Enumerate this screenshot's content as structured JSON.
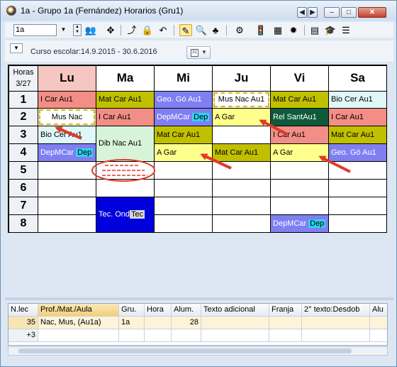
{
  "window": {
    "title": "1a - Grupo 1a (Fernández)  Horarios  (Gru1)"
  },
  "titlebar_buttons": {
    "prev": "◀",
    "next": "▶",
    "minimize": "–",
    "maximize": "□",
    "close": "✕"
  },
  "toolbar": {
    "class_value": "1a"
  },
  "course": {
    "label": "Curso escolar:14.9.2015 - 30.6.2016"
  },
  "timetable": {
    "corner_line1": "Horas",
    "corner_line2": "3/27",
    "days": [
      "Lu",
      "Ma",
      "Mi",
      "Ju",
      "Vi",
      "Sa"
    ],
    "periods": [
      "1",
      "2",
      "3",
      "4",
      "5",
      "6",
      "7",
      "8"
    ],
    "lessons": [
      {
        "text": "I   Car Au1",
        "tag": "",
        "bg": "#f28e86"
      },
      {
        "text": "Mus  Nac",
        "tag": "",
        "bg": "#ffffff"
      },
      {
        "text": "Bio  Cer Au1",
        "tag": "",
        "bg": "#e0f7f9"
      },
      {
        "text": "DepMCar ",
        "tag": "Dep",
        "bg": "#7f7ff2"
      },
      {
        "text": "Mat Car Au1",
        "tag": "",
        "bg": "#c0c000"
      },
      {
        "text": "I   Car Au1",
        "tag": "",
        "bg": "#f28e86"
      },
      {
        "text": "Dib  Nac Au1",
        "tag": "",
        "bg": "#d8f4d8"
      },
      {
        "text": "Tec. Ond",
        "tag": "Tec",
        "bg": "#0000dd"
      },
      {
        "text": "Geo. Gó  Au1",
        "tag": "",
        "bg": "#7f7ff2"
      },
      {
        "text": "DepMCar ",
        "tag": "Dep",
        "bg": "#7f7ff2"
      },
      {
        "text": "Mat Car Au1",
        "tag": "",
        "bg": "#c0c000"
      },
      {
        "text": "A    Gar",
        "tag": "",
        "bg": "#ffff8c"
      },
      {
        "text": "Mus Nac Au1",
        "tag": "",
        "bg": "#ffffff"
      },
      {
        "text": "A    Gar",
        "tag": "",
        "bg": "#ffff8c"
      },
      {
        "text": "Mat Car Au1",
        "tag": "",
        "bg": "#c0c000"
      },
      {
        "text": "Mat Car Au1",
        "tag": "",
        "bg": "#c0c000"
      },
      {
        "text": "Rel  SantAu1",
        "tag": "",
        "bg": "#105a3c"
      },
      {
        "text": "I   Car Au1",
        "tag": "",
        "bg": "#f28e86"
      },
      {
        "text": "A    Gar",
        "tag": "",
        "bg": "#ffff8c"
      },
      {
        "text": "DepMCar ",
        "tag": "Dep",
        "bg": "#7f7ff2"
      },
      {
        "text": "Bio  Cer Au1",
        "tag": "",
        "bg": "#e0f7f9"
      },
      {
        "text": "I   Car Au1",
        "tag": "",
        "bg": "#f28e86"
      },
      {
        "text": "Mat Car Au1",
        "tag": "",
        "bg": "#c0c000"
      },
      {
        "text": "Geo. Gó  Au1",
        "tag": "",
        "bg": "#7f7ff2"
      }
    ]
  },
  "lesson_table": {
    "headers": [
      "N.lec",
      "Prof./Mat./Aula",
      "Gru.",
      "Hora",
      "Alum.",
      "Texto adicional",
      "Franja",
      "2° texto:Desdob",
      "Alu"
    ],
    "rows": [
      [
        "35",
        "Nac, Mus,  (Au1a)",
        "1a",
        "",
        "28",
        "",
        "",
        "",
        ""
      ],
      [
        "+3",
        "",
        "",
        "",
        "",
        "",
        "",
        "",
        ""
      ]
    ]
  }
}
